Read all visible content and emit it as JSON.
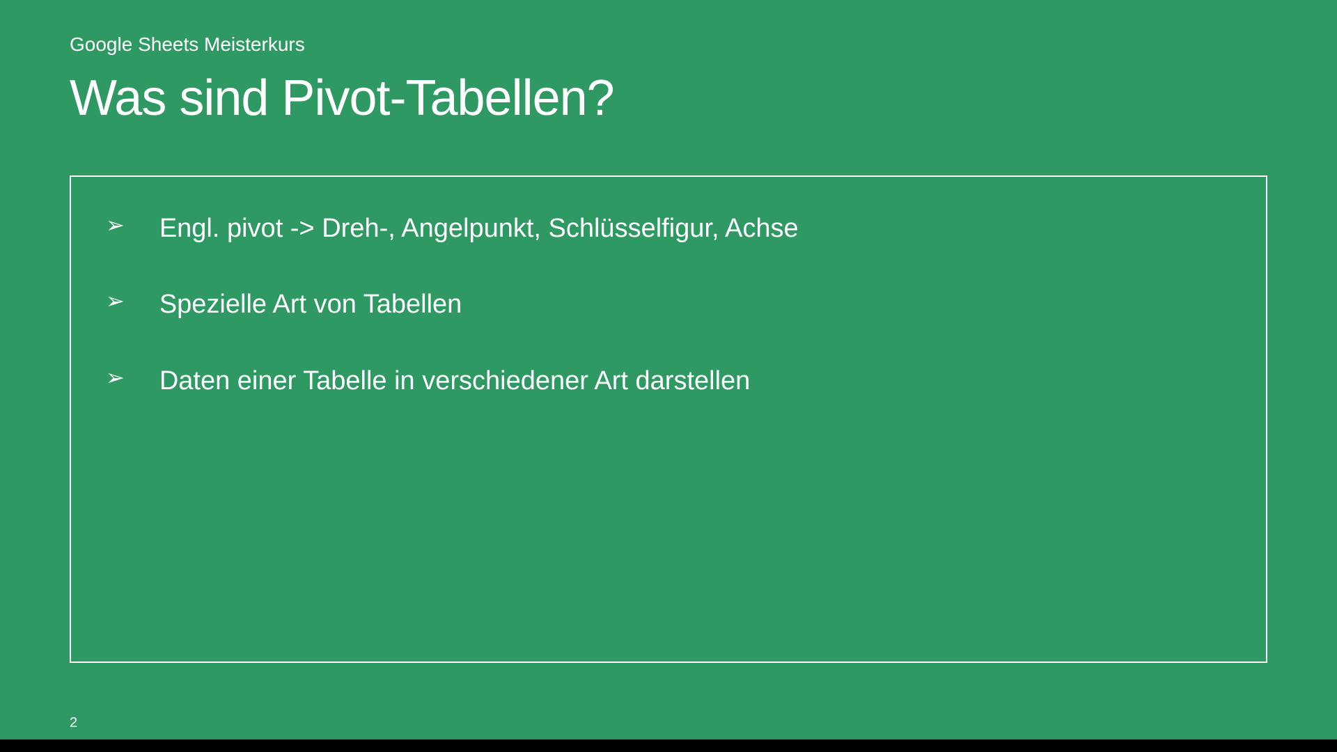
{
  "slide": {
    "subtitle": "Google Sheets Meisterkurs",
    "title": "Was sind Pivot-Tabellen?",
    "bullets": [
      "Engl. pivot -> Dreh-, Angelpunkt, Schlüsselfigur, Achse",
      "Spezielle Art von Tabellen",
      "Daten einer Tabelle in verschiedener Art darstellen"
    ],
    "page_number": "2",
    "bullet_glyph": "➢"
  }
}
